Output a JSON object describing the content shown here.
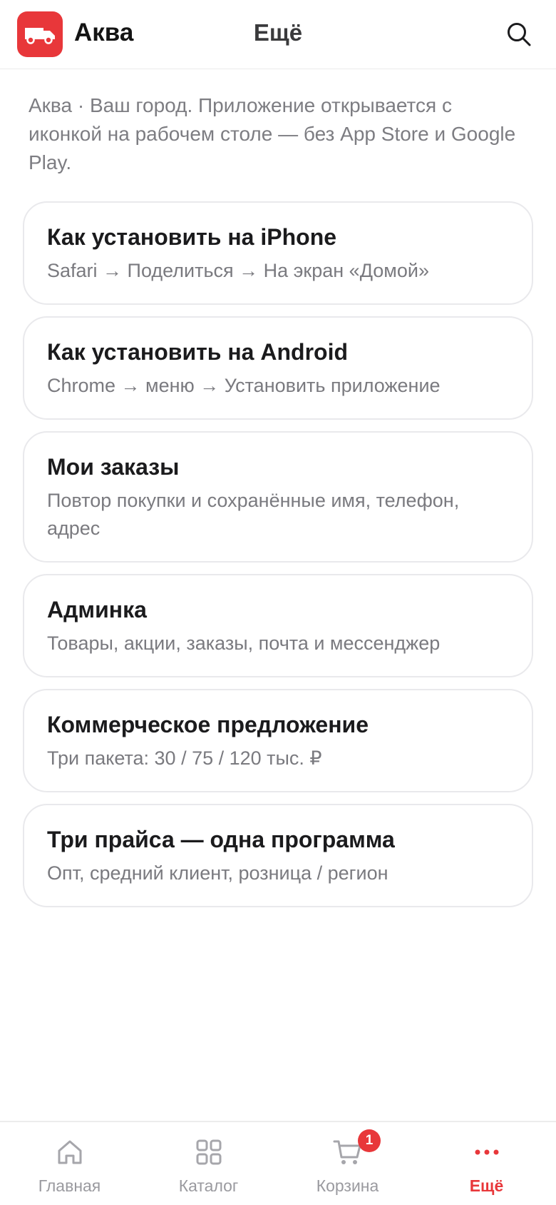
{
  "header": {
    "brand": "Аква",
    "title": "Ещё",
    "brand_color": "#e8373a"
  },
  "intro": "Аква · Ваш город. Приложение открывается с иконкой на рабочем столе — без App Store и Google Play.",
  "cards": [
    {
      "title": "Как установить на iPhone",
      "subtitle": "Safari → Поделиться → На экран «Домой»"
    },
    {
      "title": "Как установить на Android",
      "subtitle": "Chrome → меню → Установить приложение"
    },
    {
      "title": "Мои заказы",
      "subtitle": "Повтор покупки и сохранённые имя, телефон, адрес"
    },
    {
      "title": "Админка",
      "subtitle": "Товары, акции, заказы, почта и мессенджер"
    },
    {
      "title": "Коммерческое предложение",
      "subtitle": "Три пакета: 30 / 75 / 120 тыс. ₽"
    },
    {
      "title": "Три прайса — одна программа",
      "subtitle": "Опт, средний клиент, розница / регион"
    }
  ],
  "nav": {
    "home": "Главная",
    "catalog": "Каталог",
    "cart": "Корзина",
    "cart_badge": "1",
    "more": "Ещё",
    "active": "more",
    "active_color": "#e8373a"
  }
}
